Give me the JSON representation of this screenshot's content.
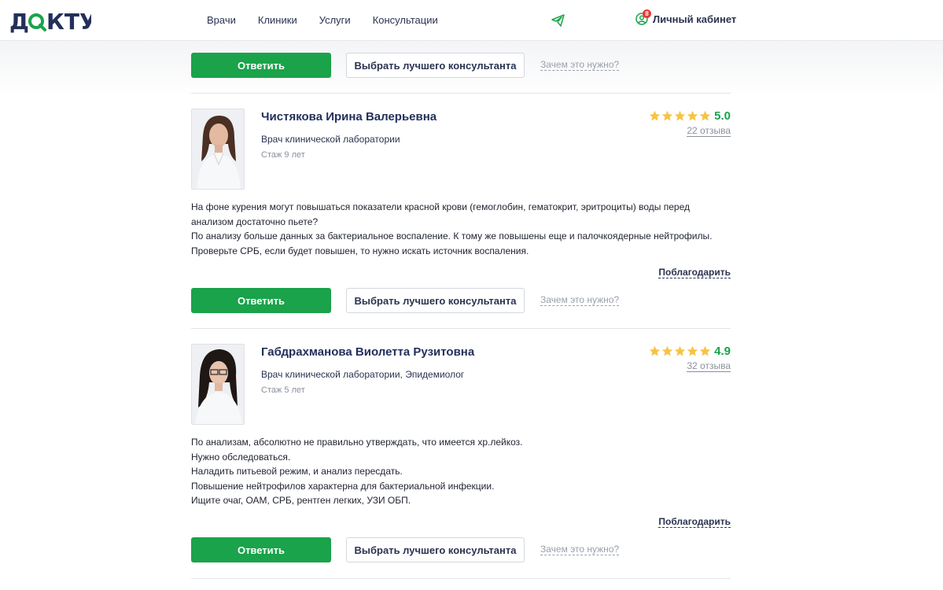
{
  "header": {
    "logo_text": "ДОКТУ",
    "nav": [
      "Врачи",
      "Клиники",
      "Услуги",
      "Консультации"
    ],
    "cabinet_label": "Личный кабинет",
    "notification_count": "8",
    "brand_color": "#1aa34a"
  },
  "actions": {
    "answer_label": "Ответить",
    "best_label": "Выбрать лучшего консультанта",
    "why_label": "Зачем это нужно?",
    "thank_label": "Поблагодарить"
  },
  "answers": [
    {
      "name": "Чистякова Ирина Валерьевна",
      "specialty": "Врач клинической лаборатории",
      "experience": "Стаж 9 лет",
      "rating": "5.0",
      "reviews": "22 отзыва",
      "text": [
        "На фоне курения могут повышаться показатели красной крови (гемоглобин, гематокрит, эритроциты) воды перед",
        "анализом достаточно пьете?",
        "По анализу больше данных за бактериальное воспаление. К тому же повышены еще и палочкоядерные нейтрофилы.",
        "Проверьте СРБ, если будет повышен, то нужно искать источник воспаления."
      ]
    },
    {
      "name": "Габдрахманова Виолетта Рузитовна",
      "specialty": "Врач клинической лаборатории, Эпидемиолог",
      "experience": "Стаж 5 лет",
      "rating": "4.9",
      "reviews": "32 отзыва",
      "text": [
        "По анализам, абсолютно не правильно утверждать, что имеется хр.лейкоз.",
        "Нужно обследоваться.",
        "Наладить питьевой режим, и анализ пересдать.",
        "Повышение нейтрофилов характерна для бактериальной инфекции.",
        "Ищите очаг, ОАМ, СРБ, рентген легких, УЗИ ОБП."
      ]
    }
  ]
}
